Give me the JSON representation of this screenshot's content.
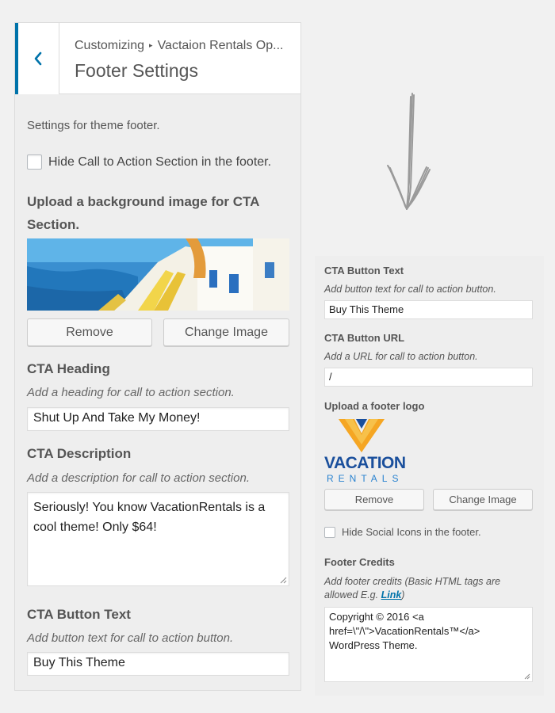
{
  "header": {
    "breadcrumb_root": "Customizing",
    "breadcrumb_separator": "▸",
    "breadcrumb_section": "Vactaion Rentals Op...",
    "title": "Footer Settings"
  },
  "left": {
    "description": "Settings for theme footer.",
    "hide_cta_label": "Hide Call to Action Section in the footer.",
    "upload_bg_title": "Upload a background image for CTA Section.",
    "remove_label": "Remove",
    "change_image_label": "Change Image",
    "cta_heading_title": "CTA Heading",
    "cta_heading_help": "Add a heading for call to action section.",
    "cta_heading_value": "Shut Up And Take My Money!",
    "cta_description_title": "CTA Description",
    "cta_description_help": "Add a description for call to action section.",
    "cta_description_value": "Seriously! You know VacationRentals is a cool theme! Only $64!",
    "cta_button_text_title": "CTA Button Text",
    "cta_button_text_help": "Add button text for call to action button.",
    "cta_button_text_value": "Buy This Theme"
  },
  "right": {
    "cta_button_text_title": "CTA Button Text",
    "cta_button_text_help": "Add button text for call to action button.",
    "cta_button_text_value": "Buy This Theme",
    "cta_button_url_title": "CTA Button URL",
    "cta_button_url_help": "Add a URL for call to action button.",
    "cta_button_url_value": "/",
    "upload_logo_title": "Upload a footer logo",
    "logo_line1": "VACATION",
    "logo_line2": "RENTALS",
    "remove_label": "Remove",
    "change_image_label": "Change Image",
    "hide_social_label": "Hide Social Icons in the footer.",
    "footer_credits_title": "Footer Credits",
    "footer_credits_help": "Add footer credits (Basic HTML tags are allowed E.g.",
    "footer_credits_link": "Link",
    "footer_credits_help_end": ")",
    "footer_credits_value": "Copyright © 2016 <a href=\\\"/\\\">VacationRentals™</a> WordPress Theme."
  },
  "colors": {
    "accent": "#0073aa",
    "panel_bg": "#eeeeee",
    "page_bg": "#f1f1f1",
    "logo_orange": "#f5a623",
    "logo_blue": "#1a4f9c"
  },
  "icons": {
    "back": "chevron-left-icon",
    "arrow": "hand-drawn-arrow-down-icon"
  },
  "state": {
    "hide_cta_checked": false,
    "hide_social_checked": false
  }
}
